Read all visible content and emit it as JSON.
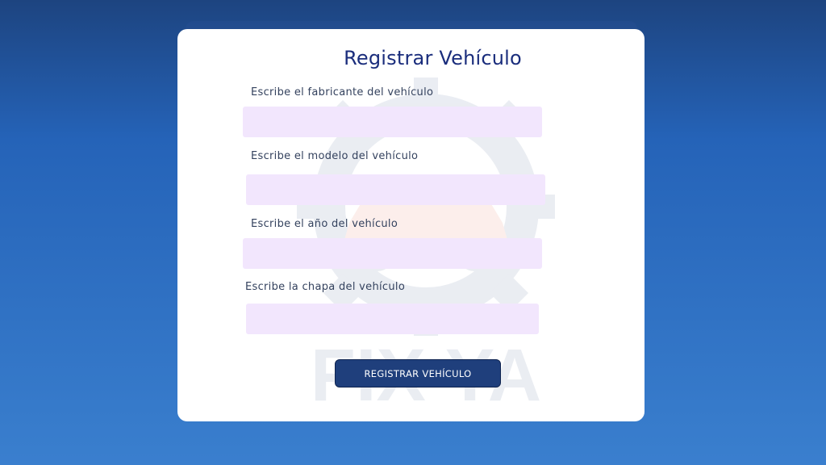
{
  "form": {
    "title": "Registrar Vehículo",
    "fields": [
      {
        "label": "Escribe el fabricante del vehículo",
        "value": "",
        "placeholder": ""
      },
      {
        "label": "Escribe el modelo del vehículo",
        "value": "",
        "placeholder": ""
      },
      {
        "label": "Escribe el año del vehículo",
        "value": "",
        "placeholder": ""
      },
      {
        "label": "Escribe la chapa del vehículo",
        "value": "",
        "placeholder": ""
      }
    ],
    "submit_label": "REGISTRAR VEHÍCULO"
  },
  "watermark": {
    "text": "FIX YA",
    "icon": "gear-car-logo"
  },
  "colors": {
    "accent": "#1a2d7c",
    "button": "#1f3f7c",
    "field_bg": "#f2e6fd",
    "background_top": "#1d4480",
    "background_bottom": "#3a7fce"
  }
}
